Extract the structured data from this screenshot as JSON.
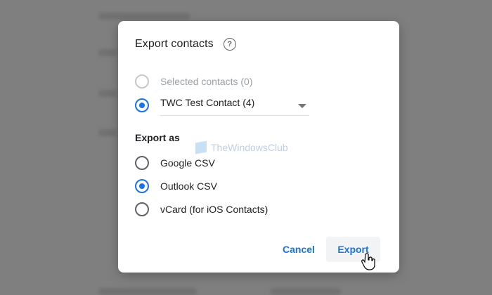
{
  "dialog": {
    "title": "Export contacts",
    "help_icon": "help-circle-icon"
  },
  "source": {
    "selected_contacts_label": "Selected contacts (0)",
    "selected_contacts_disabled": true,
    "label_option": "TWC Test Contact (4)",
    "label_option_checked": true
  },
  "export_as": {
    "section_label": "Export as",
    "options": [
      {
        "label": "Google CSV",
        "checked": false
      },
      {
        "label": "Outlook CSV",
        "checked": true
      },
      {
        "label": "vCard (for iOS Contacts)",
        "checked": false
      }
    ]
  },
  "actions": {
    "cancel_label": "Cancel",
    "export_label": "Export"
  },
  "watermark": {
    "text": "TheWindowsClub"
  },
  "colors": {
    "accent": "#1a73e8",
    "overlay": "#7f7f7f"
  }
}
